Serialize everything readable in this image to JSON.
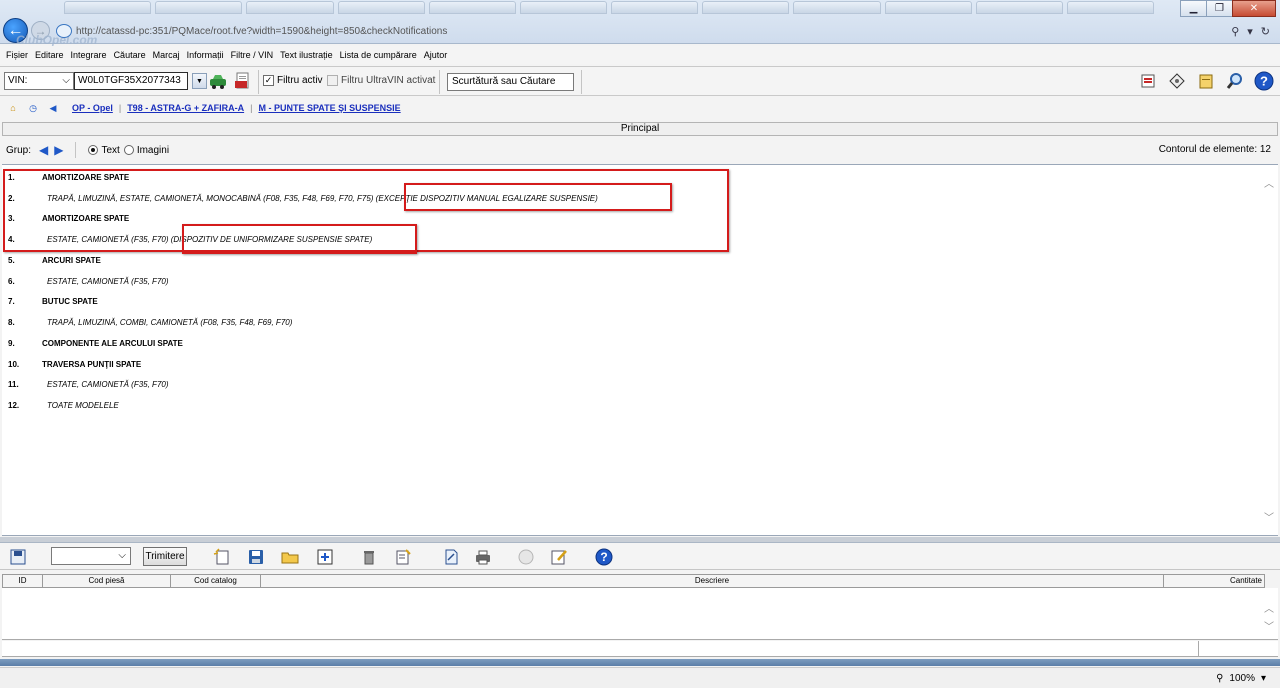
{
  "browser": {
    "url": "http://catassd-pc:351/PQMace/root.fve?width=1590&height=850&checkNotifications",
    "url_host": "catassd-pc",
    "watermark": "ClubOpel.com"
  },
  "menu": [
    "Fișier",
    "Editare",
    "Integrare",
    "Căutare",
    "Marcaj",
    "Informații",
    "Filtre / VIN",
    "Text ilustrație",
    "Lista de cumpărare",
    "Ajutor"
  ],
  "toolbar": {
    "vin_label": "VIN:",
    "vin_value": "W0L0TGF35X2077343",
    "filter_active_label": "Filtru activ",
    "filter_active_checked": true,
    "ultravin_label": "Filtru UltraVIN activat",
    "ultravin_checked": false,
    "search_placeholder": "Scurtătură sau Căutare"
  },
  "breadcrumb": [
    "OP - Opel",
    "T98 - ASTRA-G + ZAFIRA-A",
    "M - PUNTE SPATE ŞI SUSPENSIE"
  ],
  "principal_label": "Principal",
  "group": {
    "label": "Grup:",
    "text_option": "Text",
    "images_option": "Imagini",
    "selected": "Text",
    "count_text": "Contorul de elemente: 12"
  },
  "items": [
    {
      "num": "1.",
      "text": "AMORTIZOARE SPATE",
      "style": "bold"
    },
    {
      "num": "2.",
      "text": "TRAPĂ, LIMUZINĂ, ESTATE, CAMIONETĂ, MONOCABINĂ (F08, F35, F48, F69, F70, F75) (EXCEPŢIE DISPOZITIV MANUAL EGALIZARE SUSPENSIE)",
      "style": "italic"
    },
    {
      "num": "3.",
      "text": "AMORTIZOARE SPATE",
      "style": "bold"
    },
    {
      "num": "4.",
      "text": "ESTATE, CAMIONETĂ (F35, F70) (DISPOZITIV DE UNIFORMIZARE SUSPENSIE SPATE)",
      "style": "italic"
    },
    {
      "num": "5.",
      "text": "ARCURI SPATE",
      "style": "bold"
    },
    {
      "num": "6.",
      "text": "ESTATE, CAMIONETĂ (F35, F70)",
      "style": "italic"
    },
    {
      "num": "7.",
      "text": "BUTUC SPATE",
      "style": "bold"
    },
    {
      "num": "8.",
      "text": "TRAPĂ, LIMUZINĂ, COMBI, CAMIONETĂ (F08, F35, F48, F69, F70)",
      "style": "italic"
    },
    {
      "num": "9.",
      "text": "COMPONENTE ALE ARCULUI SPATE",
      "style": "bold"
    },
    {
      "num": "10.",
      "text": "TRAVERSA PUNŢII SPATE",
      "style": "bold"
    },
    {
      "num": "11.",
      "text": "ESTATE, CAMIONETĂ (F35, F70)",
      "style": "italic"
    },
    {
      "num": "12.",
      "text": "TOATE MODELELE",
      "style": "italic"
    }
  ],
  "bottom": {
    "send_label": "Trimitere",
    "columns": [
      "ID",
      "Cod piesă",
      "Cod catalog",
      "Descriere",
      "Cantitate"
    ]
  },
  "status": {
    "zoom": "100%"
  },
  "colors": {
    "highlight": "#d41b1b",
    "link": "#1a2fbd",
    "accent": "#1f58c7"
  }
}
